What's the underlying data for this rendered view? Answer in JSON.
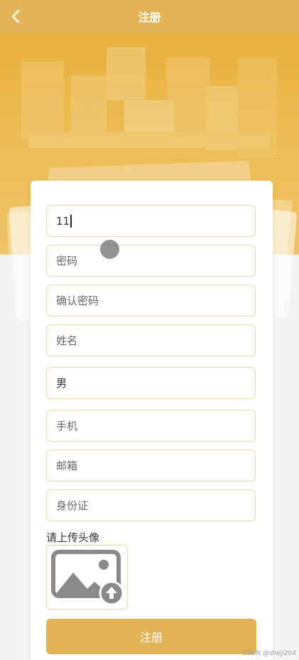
{
  "header": {
    "title": "注册",
    "back_icon": "chevron-left-icon"
  },
  "form": {
    "account_value": "11",
    "password_placeholder": "密码",
    "confirm_password_placeholder": "确认密码",
    "name_placeholder": "姓名",
    "gender_value": "男",
    "phone_placeholder": "手机",
    "email_placeholder": "邮箱",
    "id_card_placeholder": "身份证",
    "avatar_label": "请上传头像",
    "avatar_icon": "image-upload-icon",
    "submit_label": "注册"
  },
  "watermark": "CSDN @sheji204",
  "colors": {
    "accent": "#e2b457",
    "field_border": "#ecd9ab",
    "hero": "#e7b13f"
  }
}
